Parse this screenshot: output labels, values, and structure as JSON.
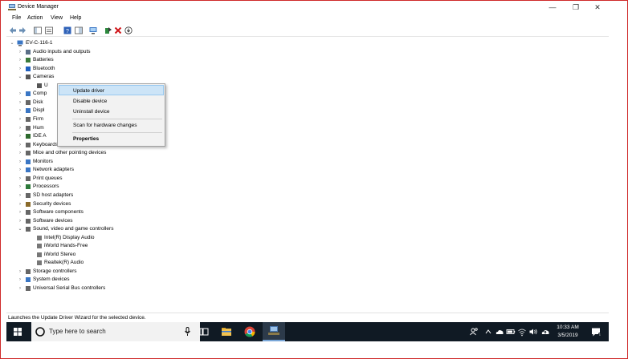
{
  "window": {
    "title": "Device Manager",
    "minimize": "—",
    "maximize": "❐",
    "close": "✕"
  },
  "menu": [
    "File",
    "Action",
    "View",
    "Help"
  ],
  "tree": {
    "root": "EV-C-116-1",
    "items": [
      {
        "label": "Audio inputs and outputs"
      },
      {
        "label": "Batteries"
      },
      {
        "label": "Bluetooth"
      },
      {
        "label": "Cameras"
      },
      {
        "label": "U"
      },
      {
        "label": "Comp"
      },
      {
        "label": "Disk"
      },
      {
        "label": "Displ"
      },
      {
        "label": "Firm"
      },
      {
        "label": "Hum"
      },
      {
        "label": "IDE A"
      },
      {
        "label": "Keyboards"
      },
      {
        "label": "Mice and other pointing devices"
      },
      {
        "label": "Monitors"
      },
      {
        "label": "Network adapters"
      },
      {
        "label": "Print queues"
      },
      {
        "label": "Processors"
      },
      {
        "label": "SD host adapters"
      },
      {
        "label": "Security devices"
      },
      {
        "label": "Software components"
      },
      {
        "label": "Software devices"
      },
      {
        "label": "Sound, video and game controllers"
      },
      {
        "label": "Intel(R) Display Audio"
      },
      {
        "label": "iWorld Hands-Free"
      },
      {
        "label": "iWorld Stereo"
      },
      {
        "label": "Realtek(R) Audio"
      },
      {
        "label": "Storage controllers"
      },
      {
        "label": "System devices"
      },
      {
        "label": "Universal Serial Bus controllers"
      }
    ]
  },
  "context_menu": {
    "items": [
      "Update driver",
      "Disable device",
      "Uninstall device",
      "Scan for hardware changes",
      "Properties"
    ]
  },
  "status": "Launches the Update Driver Wizard for the selected device.",
  "taskbar": {
    "search_placeholder": "Type here to search",
    "time": "10:33 AM",
    "date": "3/5/2019"
  }
}
